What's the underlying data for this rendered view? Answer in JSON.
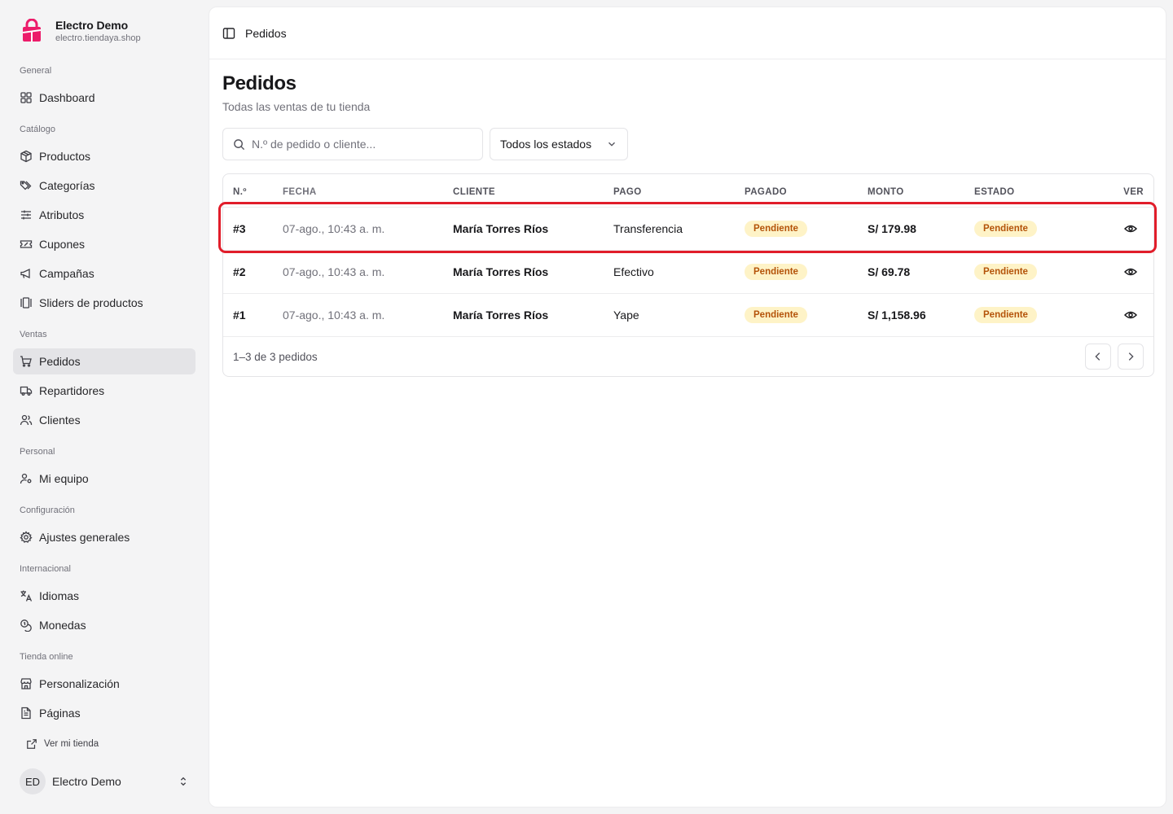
{
  "brand": {
    "name": "Electro Demo",
    "url": "electro.tiendaya.shop"
  },
  "nav": {
    "general": {
      "label": "General",
      "items": [
        {
          "label": "Dashboard",
          "icon": "dashboard-icon"
        }
      ]
    },
    "catalogo": {
      "label": "Catálogo",
      "items": [
        {
          "label": "Productos",
          "icon": "package-icon"
        },
        {
          "label": "Categorías",
          "icon": "tags-icon"
        },
        {
          "label": "Atributos",
          "icon": "sliders-icon"
        },
        {
          "label": "Cupones",
          "icon": "ticket-icon"
        },
        {
          "label": "Campañas",
          "icon": "megaphone-icon"
        },
        {
          "label": "Sliders de productos",
          "icon": "gallery-icon"
        }
      ]
    },
    "ventas": {
      "label": "Ventas",
      "items": [
        {
          "label": "Pedidos",
          "icon": "cart-icon"
        },
        {
          "label": "Repartidores",
          "icon": "truck-icon"
        },
        {
          "label": "Clientes",
          "icon": "users-icon"
        }
      ]
    },
    "personal": {
      "label": "Personal",
      "items": [
        {
          "label": "Mi equipo",
          "icon": "user-key-icon"
        }
      ]
    },
    "config": {
      "label": "Configuración",
      "items": [
        {
          "label": "Ajustes generales",
          "icon": "gear-icon"
        }
      ]
    },
    "intl": {
      "label": "Internacional",
      "items": [
        {
          "label": "Idiomas",
          "icon": "language-icon"
        },
        {
          "label": "Monedas",
          "icon": "coins-icon"
        }
      ]
    },
    "tienda": {
      "label": "Tienda online",
      "items": [
        {
          "label": "Personalización",
          "icon": "store-icon"
        },
        {
          "label": "Páginas",
          "icon": "file-icon"
        }
      ]
    },
    "ver_tienda": "Ver mi tienda"
  },
  "user": {
    "initials": "ED",
    "name": "Electro Demo"
  },
  "topbar": {
    "title": "Pedidos"
  },
  "page": {
    "title": "Pedidos",
    "subtitle": "Todas las ventas de tu tienda"
  },
  "filters": {
    "search_placeholder": "N.º de pedido o cliente...",
    "status_value": "Todos los estados"
  },
  "table": {
    "headers": [
      "N.º",
      "FECHA",
      "CLIENTE",
      "PAGO",
      "PAGADO",
      "MONTO",
      "ESTADO",
      "VER"
    ],
    "rows": [
      {
        "num": "#3",
        "date": "07-ago., 10:43 a. m.",
        "client": "María Torres Ríos",
        "payment": "Transferencia",
        "paid": "Pendiente",
        "amount": "S/ 179.98",
        "status": "Pendiente"
      },
      {
        "num": "#2",
        "date": "07-ago., 10:43 a. m.",
        "client": "María Torres Ríos",
        "payment": "Efectivo",
        "paid": "Pendiente",
        "amount": "S/ 69.78",
        "status": "Pendiente"
      },
      {
        "num": "#1",
        "date": "07-ago., 10:43 a. m.",
        "client": "María Torres Ríos",
        "payment": "Yape",
        "paid": "Pendiente",
        "amount": "S/ 1,158.96",
        "status": "Pendiente"
      }
    ],
    "footer": "1–3 de 3 pedidos"
  },
  "colors": {
    "badge_bg": "#fef3c7",
    "badge_text": "#b45309",
    "highlight": "#e11d2a",
    "brand": "#ec1c6a"
  }
}
